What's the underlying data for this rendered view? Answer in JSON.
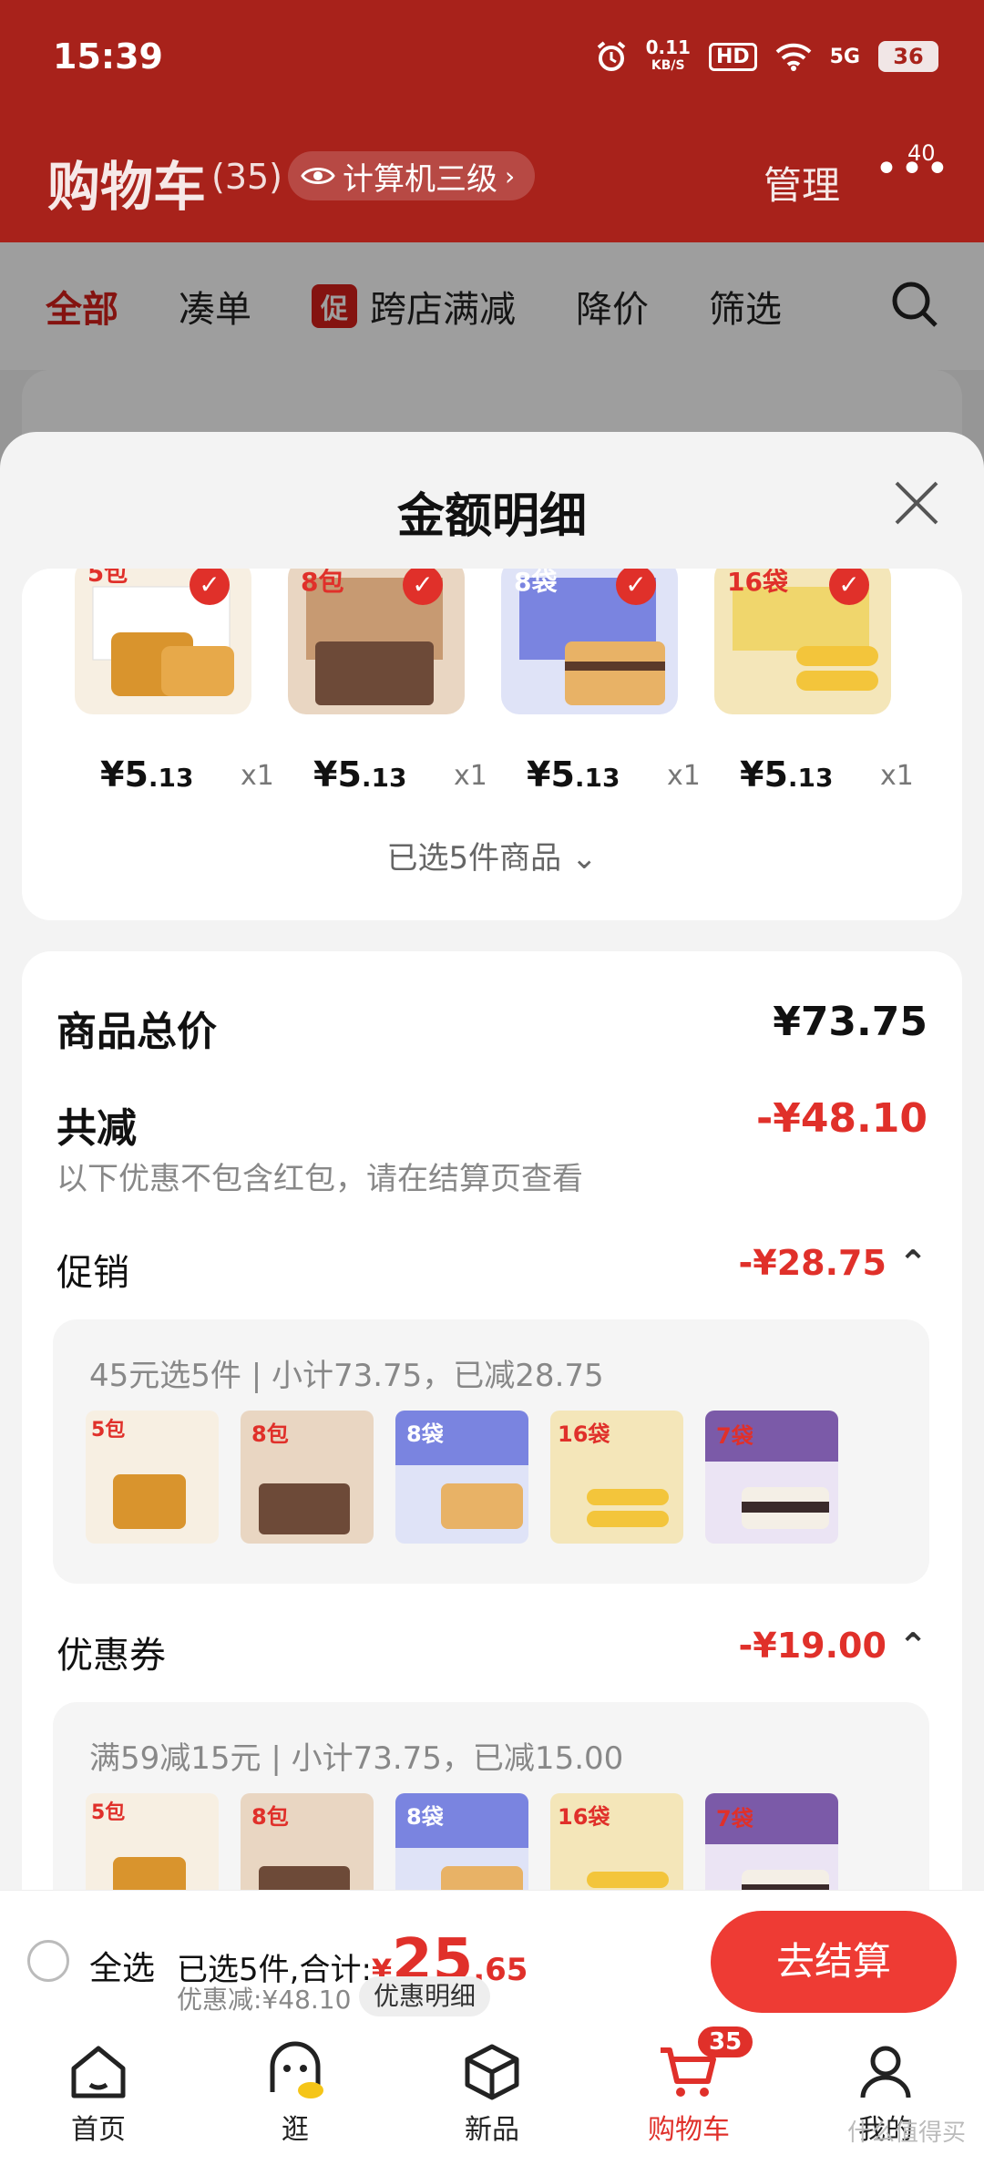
{
  "status": {
    "time": "15:39",
    "net_top": "0.11",
    "net_unit": "KB/S",
    "hd": "HD",
    "signal": "5G",
    "battery": "36"
  },
  "header": {
    "title": "购物车",
    "count": "(35)",
    "tag": "计算机三级",
    "manage": "管理",
    "more_badge": "40"
  },
  "filters": {
    "items": [
      "全部",
      "凑单",
      "跨店满减",
      "降价",
      "筛选"
    ],
    "promo_badge": "促"
  },
  "sheet": {
    "title": "金额明细",
    "products": [
      {
        "currency": "¥",
        "int": "5",
        "dec": ".13",
        "qty": "x1"
      },
      {
        "currency": "¥",
        "int": "5",
        "dec": ".13",
        "qty": "x1"
      },
      {
        "currency": "¥",
        "int": "5",
        "dec": ".13",
        "qty": "x1"
      },
      {
        "currency": "¥",
        "int": "5",
        "dec": ".13",
        "qty": "x1"
      }
    ],
    "selected_label": "已选5件商品",
    "total_label": "商品总价",
    "total_value": "¥73.75",
    "reduce_label": "共减",
    "reduce_value": "-¥48.10",
    "reduce_note": "以下优惠不包含红包，请在结算页查看",
    "promo": {
      "label": "促销",
      "value": "-¥28.75",
      "desc": "45元选5件 | 小计73.75，已减28.75"
    },
    "coupon": {
      "label": "优惠券",
      "value": "-¥19.00",
      "desc": "满59减15元 | 小计73.75，已减15.00"
    },
    "thumb_labels": [
      "5包",
      "8包",
      "8袋",
      "16袋",
      "7袋"
    ]
  },
  "bottom": {
    "select_all": "全选",
    "summary_prefix": "已选5件,合计:",
    "currency": "¥",
    "total_int": "25",
    "total_dec": ".65",
    "discount": "优惠减:¥48.10",
    "detail_button": "优惠明细",
    "checkout": "去结算"
  },
  "tabs": {
    "items": [
      "首页",
      "逛",
      "新品",
      "购物车",
      "我的"
    ],
    "cart_badge": "35"
  },
  "watermark": "什么值得买"
}
